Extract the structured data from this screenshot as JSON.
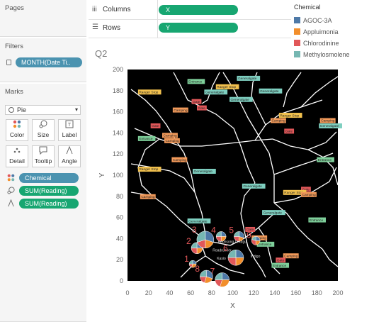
{
  "panels": {
    "pages_title": "Pages",
    "filters_title": "Filters",
    "filter_pill": "MONTH(Date Ti..",
    "marks_title": "Marks",
    "mark_type": "Pie",
    "buttons": {
      "color": "Color",
      "size": "Size",
      "label": "Label",
      "detail": "Detail",
      "tooltip": "Tooltip",
      "angle": "Angle"
    },
    "mark_pills": {
      "color": "Chemical",
      "size": "SUM(Reading)",
      "angle": "SUM(Reading)"
    }
  },
  "shelves": {
    "columns_label": "Columns",
    "columns_pill": "X",
    "rows_label": "Rows",
    "rows_pill": "Y"
  },
  "legend": {
    "title": "Chemical",
    "items": [
      {
        "label": "AGOC-3A",
        "color": "#4e79a7"
      },
      {
        "label": "Appluimonia",
        "color": "#f28e2b"
      },
      {
        "label": "Chlorodinine",
        "color": "#e15759"
      },
      {
        "label": "Methylosmolene",
        "color": "#76b7b2"
      }
    ]
  },
  "viz_title": "Q2",
  "chart_data": {
    "type": "scatter",
    "xlabel": "X",
    "ylabel": "Y",
    "xlim": [
      0,
      200
    ],
    "ylim": [
      0,
      200
    ],
    "x_ticks": [
      "0",
      "20",
      "40",
      "60",
      "80",
      "100",
      "120",
      "140",
      "160",
      "180",
      "200"
    ],
    "y_ticks": [
      "0",
      "20",
      "40",
      "60",
      "80",
      "100",
      "120",
      "140",
      "160",
      "180",
      "200"
    ],
    "background": "#000000",
    "sensors": [
      {
        "id": "1",
        "x": 62,
        "y": 16,
        "r": 5,
        "shares": [
          0.25,
          0.3,
          0.2,
          0.25
        ]
      },
      {
        "id": "2",
        "x": 66,
        "y": 31,
        "r": 8,
        "shares": [
          0.25,
          0.25,
          0.25,
          0.25
        ]
      },
      {
        "id": "3",
        "x": 74,
        "y": 39,
        "r": 12,
        "shares": [
          0.3,
          0.2,
          0.2,
          0.3
        ]
      },
      {
        "id": "4",
        "x": 89,
        "y": 42,
        "r": 7,
        "shares": [
          0.25,
          0.25,
          0.25,
          0.25
        ]
      },
      {
        "id": "5",
        "x": 106,
        "y": 42,
        "r": 7,
        "shares": [
          0.3,
          0.2,
          0.25,
          0.25
        ]
      },
      {
        "id": "6",
        "x": 103,
        "y": 22,
        "r": 11,
        "shares": [
          0.25,
          0.25,
          0.25,
          0.25
        ]
      },
      {
        "id": "7",
        "x": 90,
        "y": 1,
        "r": 10,
        "shares": [
          0.25,
          0.3,
          0.2,
          0.25
        ]
      },
      {
        "id": "8",
        "x": 75,
        "y": 4,
        "r": 9,
        "shares": [
          0.3,
          0.25,
          0.2,
          0.25
        ]
      },
      {
        "id": "9",
        "x": 122,
        "y": 38,
        "r": 6,
        "shares": [
          0.25,
          0.25,
          0.3,
          0.2
        ]
      }
    ],
    "place_labels": [
      {
        "text": "Entrance",
        "x": 57,
        "y": 187,
        "category": "entrance"
      },
      {
        "text": "Generalgate",
        "x": 104,
        "y": 190,
        "category": "generalgate"
      },
      {
        "text": "Ranger Stop",
        "x": 10,
        "y": 177,
        "category": "ranger"
      },
      {
        "text": "Generalgate",
        "x": 73,
        "y": 177,
        "category": "generalgate"
      },
      {
        "text": "Ranger Stop",
        "x": 84,
        "y": 182,
        "category": "ranger"
      },
      {
        "text": "Generalgate",
        "x": 125,
        "y": 178,
        "category": "generalgate"
      },
      {
        "text": "Gate",
        "x": 61,
        "y": 168,
        "category": "gate"
      },
      {
        "text": "Generalgate",
        "x": 97,
        "y": 170,
        "category": "generalgate"
      },
      {
        "text": "Camping",
        "x": 43,
        "y": 160,
        "category": "camping"
      },
      {
        "text": "Gate",
        "x": 66,
        "y": 162,
        "category": "gate"
      },
      {
        "text": "Ranger Stop",
        "x": 144,
        "y": 155,
        "category": "ranger"
      },
      {
        "text": "Camping",
        "x": 136,
        "y": 150,
        "category": "camping"
      },
      {
        "text": "Camping",
        "x": 183,
        "y": 150,
        "category": "camping"
      },
      {
        "text": "Generalgate",
        "x": 182,
        "y": 145,
        "category": "generalgate"
      },
      {
        "text": "Gate",
        "x": 22,
        "y": 145,
        "category": "gate"
      },
      {
        "text": "Gate",
        "x": 149,
        "y": 140,
        "category": "gate"
      },
      {
        "text": "Camping",
        "x": 33,
        "y": 136,
        "category": "camping"
      },
      {
        "text": "Camping",
        "x": 35,
        "y": 131,
        "category": "camping"
      },
      {
        "text": "Entrance",
        "x": 10,
        "y": 133,
        "category": "entrance"
      },
      {
        "text": "Camping",
        "x": 42,
        "y": 113,
        "category": "camping"
      },
      {
        "text": "Ranger Stop",
        "x": 10,
        "y": 104,
        "category": "ranger"
      },
      {
        "text": "Generalgate",
        "x": 62,
        "y": 102,
        "category": "generalgate"
      },
      {
        "text": "Entrance",
        "x": 180,
        "y": 113,
        "category": "entrance"
      },
      {
        "text": "Generalgate",
        "x": 109,
        "y": 88,
        "category": "generalgate"
      },
      {
        "text": "Gate",
        "x": 165,
        "y": 85,
        "category": "gate"
      },
      {
        "text": "Ranger Stop",
        "x": 148,
        "y": 82,
        "category": "ranger"
      },
      {
        "text": "Camping",
        "x": 12,
        "y": 78,
        "category": "camping"
      },
      {
        "text": "Camping",
        "x": 165,
        "y": 80,
        "category": "camping"
      },
      {
        "text": "Generalgate",
        "x": 128,
        "y": 63,
        "category": "generalgate"
      },
      {
        "text": "Generalgate",
        "x": 57,
        "y": 55,
        "category": "generalgate"
      },
      {
        "text": "Entrance",
        "x": 172,
        "y": 56,
        "category": "entrance"
      },
      {
        "text": "Gate",
        "x": 112,
        "y": 47,
        "category": "gate"
      },
      {
        "text": "Camping",
        "x": 118,
        "y": 39,
        "category": "camping"
      },
      {
        "text": "Entrance",
        "x": 123,
        "y": 33,
        "category": "entrance"
      },
      {
        "text": "Camping",
        "x": 148,
        "y": 22,
        "category": "camping"
      },
      {
        "text": "Gate",
        "x": 141,
        "y": 18,
        "category": "gate"
      },
      {
        "text": "Entrance",
        "x": 137,
        "y": 13,
        "category": "entrance"
      },
      {
        "text": "Roadrunner",
        "x": 81,
        "y": 28,
        "category": "plain"
      },
      {
        "text": "Kasio",
        "x": 85,
        "y": 20,
        "category": "plain"
      },
      {
        "text": "Indigo",
        "x": 117,
        "y": 22,
        "category": "plain"
      },
      {
        "text": "Boonsong Lekagul",
        "x": 86,
        "y": 36,
        "category": "plain"
      }
    ]
  }
}
